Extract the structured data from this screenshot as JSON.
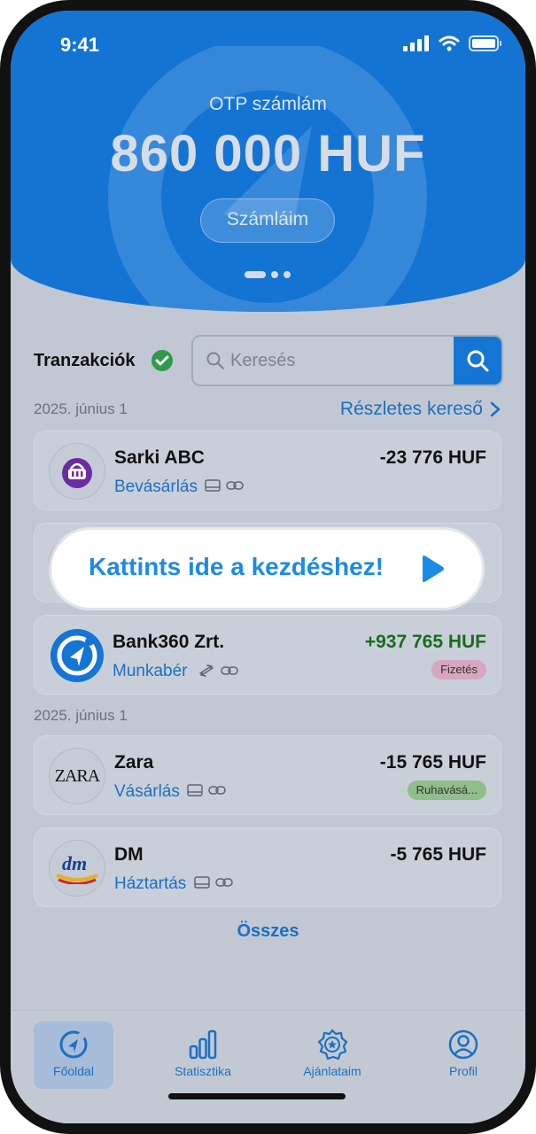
{
  "status_bar": {
    "time": "9:41"
  },
  "header": {
    "account_label": "OTP számlám",
    "balance": "860 000 HUF",
    "accounts_button": "Számláim"
  },
  "transactions": {
    "title": "Tranzakciók",
    "search_placeholder": "Keresés",
    "details_link": "Részletes kereső"
  },
  "groups": [
    {
      "date": "2025. június 1"
    },
    {
      "date": "2025. június 1"
    }
  ],
  "items": [
    {
      "merchant": "Sarki ABC",
      "category": "Bevásárlás",
      "amount": "-23 776 HUF",
      "tag": ""
    },
    {
      "merchant": "",
      "category": "",
      "amount": "",
      "tag": ""
    },
    {
      "merchant": "Bank360 Zrt.",
      "category": "Munkabér",
      "amount": "+937 765 HUF",
      "tag": "Fizetés"
    },
    {
      "merchant": "Zara",
      "category": "Vásárlás",
      "amount": "-15 765 HUF",
      "tag": "Ruhavásá..."
    },
    {
      "merchant": "DM",
      "category": "Háztartás",
      "amount": "-5 765 HUF",
      "tag": ""
    }
  ],
  "logos": {
    "zara": "ZARA",
    "dm": "dm"
  },
  "overlay": {
    "label": "Kattints ide a kezdéshez!"
  },
  "all_link": "Összes",
  "nav": {
    "home": "Főoldal",
    "stats": "Statisztika",
    "offers": "Ajánlataim",
    "profile": "Profil"
  },
  "colors": {
    "primary": "#1474d4",
    "link": "#1c6fc4",
    "positive": "#1b6b1f",
    "tag_pink": "#d8a6c0",
    "tag_green": "#8fbe8a"
  }
}
